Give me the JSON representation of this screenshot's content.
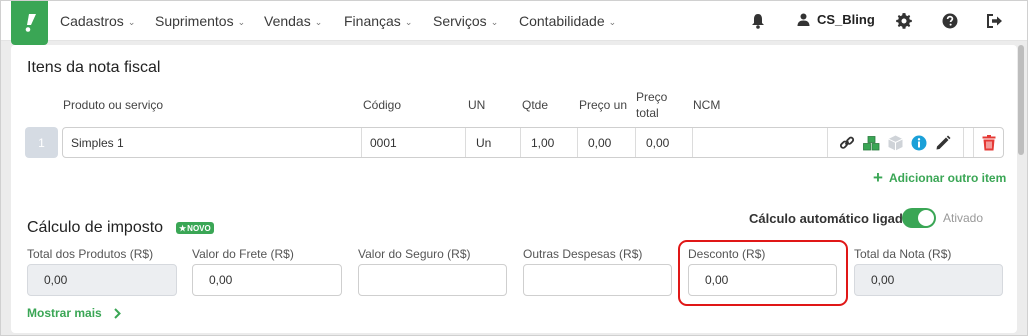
{
  "nav": {
    "menu": [
      {
        "label": "Cadastros"
      },
      {
        "label": "Suprimentos"
      },
      {
        "label": "Vendas"
      },
      {
        "label": "Finanças"
      },
      {
        "label": "Serviços"
      },
      {
        "label": "Contabilidade"
      }
    ],
    "user_name": "CS_Bling",
    "icons": [
      "bell-icon",
      "user-icon",
      "gear-icon",
      "help-icon",
      "logout-icon"
    ],
    "brand_color": "#3aa655"
  },
  "items_section": {
    "title": "Itens da nota fiscal",
    "columns": {
      "product": "Produto ou serviço",
      "code": "Código",
      "unit": "UN",
      "qty": "Qtde",
      "unit_price": "Preço un",
      "total_price_line1": "Preço",
      "total_price_line2": "total",
      "ncm": "NCM"
    },
    "rows": [
      {
        "number": "1",
        "product": "Simples 1",
        "code": "0001",
        "unit": "Un",
        "qty": "1,00",
        "unit_price": "0,00",
        "total_price": "0,00",
        "ncm": ""
      }
    ],
    "add_item_label": "Adicionar outro item"
  },
  "tax_section": {
    "title": "Cálculo de imposto",
    "badge": "NOVO",
    "auto_calc_label": "Cálculo automático ligado",
    "auto_calc_state": "Ativado",
    "auto_calc_on": true,
    "fields": {
      "total_products": {
        "label": "Total dos Produtos (R$)",
        "value": "0,00"
      },
      "freight": {
        "label": "Valor do Frete (R$)",
        "value": "0,00"
      },
      "insurance": {
        "label": "Valor do Seguro (R$)",
        "value": ""
      },
      "other_expenses": {
        "label": "Outras Despesas (R$)",
        "value": ""
      },
      "discount": {
        "label": "Desconto (R$)",
        "value": "0,00"
      },
      "total_invoice": {
        "label": "Total da Nota (R$)",
        "value": "0,00"
      }
    },
    "show_more_label": "Mostrar mais",
    "highlight_color": "#e01717"
  }
}
